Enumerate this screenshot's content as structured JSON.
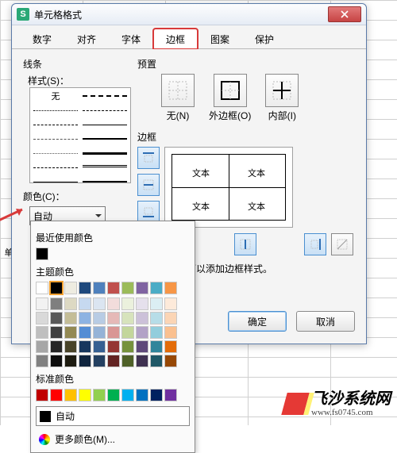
{
  "window": {
    "title": "单元格格式"
  },
  "tabs": {
    "items": [
      "数字",
      "对齐",
      "字体",
      "边框",
      "图案",
      "保护"
    ],
    "active_index": 3
  },
  "line": {
    "section": "线条",
    "style_label": "样式(S)：",
    "none_label": "无",
    "color_label": "颜色(C)：",
    "color_value": "自动"
  },
  "presets": {
    "section": "预置",
    "none": "无(N)",
    "outer": "外边框(O)",
    "inner": "内部(I)"
  },
  "border": {
    "section": "边框",
    "cell_label": "文本"
  },
  "hint": "可以添加边框样式。",
  "footer": {
    "ok": "确定",
    "cancel": "取消"
  },
  "popup": {
    "recent_title": "最近使用颜色",
    "theme_title": "主题颜色",
    "standard_title": "标准颜色",
    "auto_label": "自动",
    "more_label": "更多颜色(M)...",
    "recent_colors": [
      "#000000"
    ],
    "theme_row1": [
      "#ffffff",
      "#000000",
      "#eeece1",
      "#1f497d",
      "#4f81bd",
      "#c0504d",
      "#9bbb59",
      "#8064a2",
      "#4bacc6",
      "#f79646"
    ],
    "theme_shades": [
      [
        "#f2f2f2",
        "#7f7f7f",
        "#ddd9c3",
        "#c6d9f0",
        "#dbe5f1",
        "#f2dcdb",
        "#ebf1dd",
        "#e5e0ec",
        "#dbeef3",
        "#fdeada"
      ],
      [
        "#d9d9d9",
        "#595959",
        "#c4bd97",
        "#8db3e2",
        "#b8cce4",
        "#e5b9b7",
        "#d7e3bc",
        "#ccc1d9",
        "#b7dde8",
        "#fbd5b5"
      ],
      [
        "#bfbfbf",
        "#404040",
        "#938953",
        "#548dd4",
        "#95b3d7",
        "#d99694",
        "#c3d69b",
        "#b2a2c7",
        "#92cddc",
        "#fac08f"
      ],
      [
        "#a6a6a6",
        "#262626",
        "#494429",
        "#17365d",
        "#366092",
        "#953734",
        "#76923c",
        "#5f497a",
        "#31859b",
        "#e36c09"
      ],
      [
        "#808080",
        "#0d0d0d",
        "#1d1b10",
        "#0f243e",
        "#244061",
        "#632423",
        "#4f6128",
        "#3f3151",
        "#205867",
        "#974806"
      ]
    ],
    "standard_colors": [
      "#c00000",
      "#ff0000",
      "#ffc000",
      "#ffff00",
      "#92d050",
      "#00b050",
      "#00b0f0",
      "#0070c0",
      "#002060",
      "#7030a0"
    ]
  },
  "rowheader": {
    "label": "单"
  },
  "watermark": {
    "name": "飞沙系统网",
    "url": "www.fs0745.com"
  }
}
